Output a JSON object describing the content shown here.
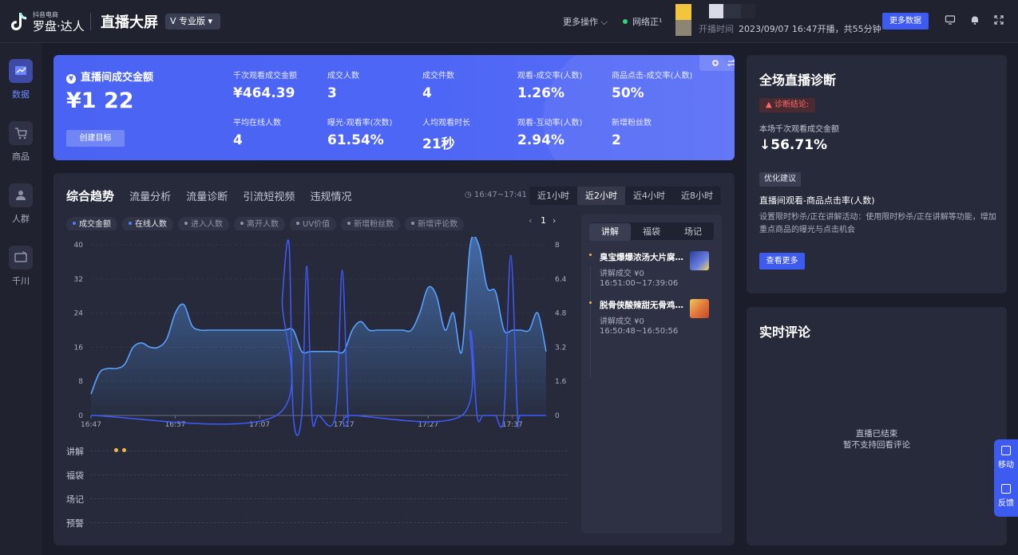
{
  "header": {
    "brand_small": "抖音电商",
    "brand_main": "罗盘·达人",
    "page_title": "直播大屏",
    "pro_badge": "V 专业版 ▾",
    "more_ops": "更多操作 ⌵",
    "network": "网络正¹",
    "start_label": "开播时间",
    "start_text": "2023/09/07 16:47开播，共55分钟",
    "more_data_btn": "更多数据",
    "icons": [
      "monitor-icon",
      "bell-icon",
      "fullscreen-icon"
    ]
  },
  "sidebar": {
    "items": [
      {
        "label": "数据",
        "icon": "data-chart-icon",
        "active": true
      },
      {
        "label": "商品",
        "icon": "cart-icon",
        "active": false
      },
      {
        "label": "人群",
        "icon": "people-icon",
        "active": false
      },
      {
        "label": "千川",
        "icon": "qianchuan-icon",
        "active": false
      }
    ]
  },
  "hero": {
    "title": "直播间成交金额",
    "value": "¥1 22",
    "target_btn": "创建目标",
    "metrics": [
      {
        "label": "千次观看成交金额",
        "value": "¥464.39"
      },
      {
        "label": "成交人数",
        "value": "3"
      },
      {
        "label": "成交件数",
        "value": "4"
      },
      {
        "label": "观看-成交率(人数)",
        "value": "1.26%"
      },
      {
        "label": "商品点击-成交率(人数)",
        "value": "50%"
      },
      {
        "label": "平均在线人数",
        "value": "4"
      },
      {
        "label": "曝光-观看率(次数)",
        "value": "61.54%"
      },
      {
        "label": "人均观看时长",
        "value": "21秒"
      },
      {
        "label": "观看-互动率(人数)",
        "value": "2.94%"
      },
      {
        "label": "新增粉丝数",
        "value": "2"
      }
    ]
  },
  "trend": {
    "tabs": [
      "综合趋势",
      "流量分析",
      "流量诊断",
      "引流短视频",
      "违规情况"
    ],
    "time_range": "16:47~17:41",
    "range_buttons": [
      "近1小时",
      "近2小时",
      "近4小时",
      "近8小时"
    ],
    "active_range": 1,
    "chips": [
      {
        "label": "成交金额",
        "on": true
      },
      {
        "label": "在线人数",
        "on": true
      },
      {
        "label": "进入人数",
        "on": false
      },
      {
        "label": "离开人数",
        "on": false
      },
      {
        "label": "UV价值",
        "on": false
      },
      {
        "label": "新增粉丝数",
        "on": false
      },
      {
        "label": "新增评论数",
        "on": false
      }
    ],
    "page": "1",
    "tracks": [
      "讲解",
      "福袋",
      "场记",
      "预警"
    ],
    "side_tabs": [
      "讲解",
      "福袋",
      "场记"
    ],
    "products": [
      {
        "title": "臭宝爆爆浓汤大片腐竹…",
        "deal": "讲解成交 ¥0",
        "period": "16:51:00~17:39:06",
        "thumb_color": "#3a4fb0"
      },
      {
        "title": "脱骨侠酸辣甜无骨鸡…",
        "deal": "讲解成交 ¥0",
        "period": "16:50:48~16:50:56",
        "thumb_color": "#e0723a"
      }
    ]
  },
  "chart_data": {
    "type": "area",
    "x_ticks": [
      "16:47",
      "16:57",
      "17:07",
      "17:17",
      "17:27",
      "17:37"
    ],
    "x_minutes": [
      0,
      54
    ],
    "ylim_left": [
      0,
      40
    ],
    "ylim_right": [
      0,
      8
    ],
    "yticks_left": [
      "0",
      "8",
      "16",
      "24",
      "32",
      "40"
    ],
    "yticks_right": [
      "0",
      "1.6",
      "3.2",
      "4.8",
      "6.4",
      "8"
    ],
    "grid": true,
    "series": [
      {
        "name": "在线人数",
        "axis": "left",
        "color": "#5aa0ff",
        "x": [
          0,
          1,
          2,
          3,
          4,
          5,
          6,
          7,
          8,
          9,
          10,
          11,
          12,
          13,
          14,
          15,
          16,
          17,
          18,
          19,
          20,
          21,
          22,
          23,
          24,
          25,
          26,
          27,
          28,
          29,
          30,
          31,
          32,
          33,
          34,
          35,
          36,
          37,
          38,
          39,
          40,
          41,
          42,
          43,
          44,
          45,
          46,
          47,
          48,
          49,
          50,
          51,
          52,
          53,
          54
        ],
        "y": [
          5,
          10,
          11,
          11,
          12,
          16,
          17,
          16,
          16,
          18,
          24,
          26,
          21,
          20,
          20,
          20,
          20,
          20,
          20,
          20,
          20,
          20,
          20,
          20,
          20,
          15,
          15,
          15,
          15,
          15,
          15,
          20,
          22,
          20,
          20,
          20,
          20,
          20,
          20,
          24,
          30,
          28,
          20,
          24,
          15,
          40,
          40,
          30,
          29,
          20,
          20,
          20,
          20,
          24,
          15
        ]
      },
      {
        "name": "成交金额",
        "axis": "right",
        "color": "#3f5bff",
        "x": [
          0,
          22,
          22.7,
          23.5,
          24,
          25,
          25.6,
          26.2,
          27,
          29,
          29.8,
          30.5,
          31,
          44,
          45,
          45.8,
          46.5,
          47.5,
          48,
          49,
          49.8,
          50.6,
          51,
          54
        ],
        "y": [
          0,
          0,
          5.5,
          8,
          0,
          0,
          7,
          0,
          0,
          0,
          6.8,
          0,
          0,
          0,
          4,
          0,
          0,
          0,
          0,
          0,
          7.5,
          0,
          0,
          0
        ]
      }
    ]
  },
  "diagnosis": {
    "title": "全场直播诊断",
    "tag": "▲ 诊断结论:",
    "metric_label": "本场千次观看成交金额",
    "metric_value": "↓56.71%",
    "opt_tag": "优化建议",
    "opt_title": "直播间观看-商品点击率(人数)",
    "opt_desc": "设置限时秒杀/正在讲解活动：使用限时秒杀/正在讲解等功能，增加重点商品的曝光与点击机会",
    "see_more": "查看更多"
  },
  "comments": {
    "title": "实时评论",
    "empty_line1": "直播已结束",
    "empty_line2": "暂不支持回看评论"
  },
  "float_bar": {
    "items": [
      "移动",
      "反馈"
    ]
  }
}
